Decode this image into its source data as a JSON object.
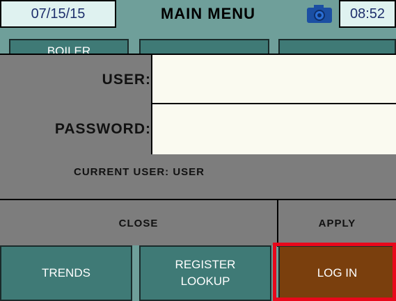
{
  "header": {
    "date": "07/15/15",
    "title": "MAIN MENU",
    "camera_icon": "camera-icon",
    "time": "08:52"
  },
  "background_menu": {
    "boiler_label": "BOILER"
  },
  "login_dialog": {
    "user_label": "USER:",
    "user_value": "",
    "password_label": "PASSWORD:",
    "password_value": "",
    "current_user": "CURRENT USER: USER",
    "close_label": "CLOSE",
    "apply_label": "APPLY"
  },
  "bottom_buttons": {
    "trends_label": "TRENDS",
    "register_line1": "REGISTER",
    "register_line2": "LOOKUP",
    "login_label": "LOG IN"
  },
  "colors": {
    "teal": "#6f9f9a",
    "button_teal": "#3f7a76",
    "dialog_gray": "#7d7d7d",
    "login_brown": "#7a3f0d",
    "highlight_red": "#e8081b"
  }
}
